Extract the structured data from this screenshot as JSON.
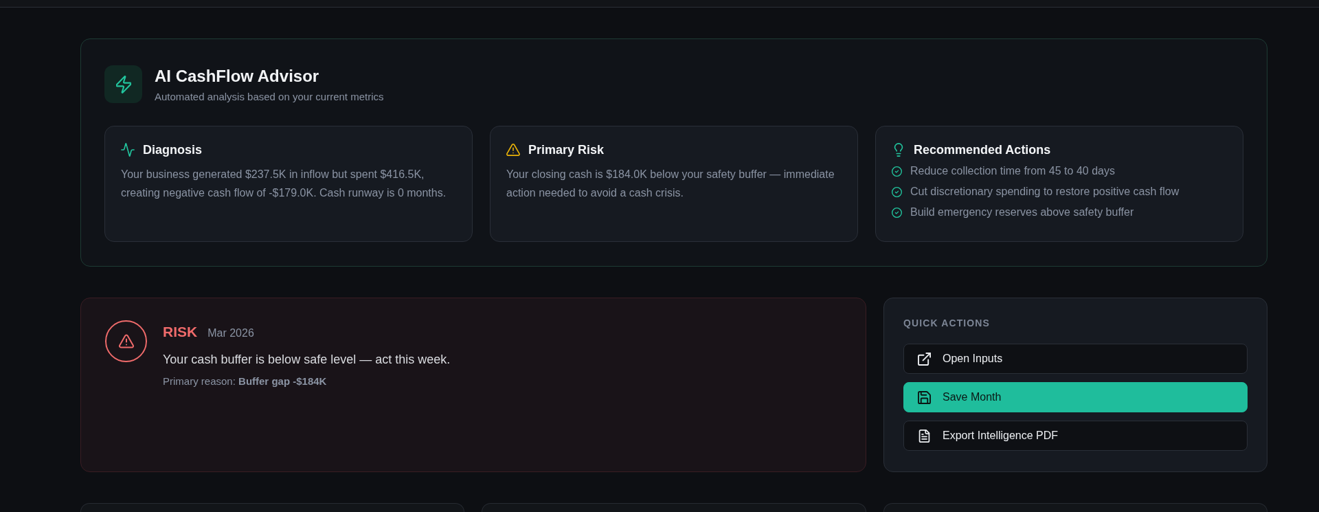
{
  "advisor": {
    "title": "AI CashFlow Advisor",
    "subtitle": "Automated analysis based on your current metrics",
    "cards": [
      {
        "kind": "diagnosis",
        "title": "Diagnosis",
        "text": "Your business generated $237.5K in inflow but spent $416.5K, creating negative cash flow of -$179.0K. Cash runway is 0 months."
      },
      {
        "kind": "risk",
        "title": "Primary Risk",
        "text": "Your closing cash is $184.0K below your safety buffer — immediate action needed to avoid a cash crisis."
      },
      {
        "kind": "actions",
        "title": "Recommended Actions",
        "items": [
          "Reduce collection time from 45 to 40 days",
          "Cut discretionary spending to restore positive cash flow",
          "Build emergency reserves above safety buffer"
        ]
      }
    ]
  },
  "alert": {
    "kind": "risk",
    "label": "RISK",
    "period": "Mar 2026",
    "message": "Your cash buffer is below safe level — act this week.",
    "reason": "Primary reason: **Buffer gap -$184K**"
  },
  "quick_actions": {
    "title": "QUICK ACTIONS",
    "buttons": [
      {
        "label": "Open Inputs",
        "kind": "secondary"
      },
      {
        "label": "Save Month",
        "kind": "primary"
      },
      {
        "label": "Export Intelligence PDF",
        "kind": "secondary"
      }
    ]
  }
}
